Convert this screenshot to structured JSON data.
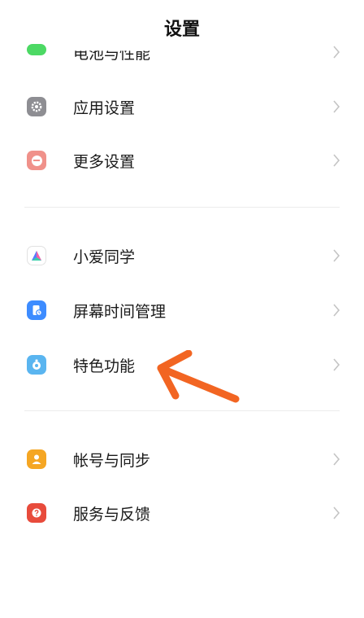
{
  "header": {
    "title": "设置"
  },
  "groups": [
    {
      "items": [
        {
          "label": "电池与性能",
          "icon": "battery-icon",
          "color": "#4cd964"
        },
        {
          "label": "应用设置",
          "icon": "gear-icon",
          "color": "#8e8e93"
        },
        {
          "label": "更多设置",
          "icon": "more-dots-icon",
          "color": "#f0918a"
        }
      ]
    },
    {
      "items": [
        {
          "label": "小爱同学",
          "icon": "xiaoai-icon",
          "color": "#ffffff"
        },
        {
          "label": "屏幕时间管理",
          "icon": "screen-time-icon",
          "color": "#3d8cff"
        },
        {
          "label": "特色功能",
          "icon": "features-icon",
          "color": "#5ab5f0"
        }
      ]
    },
    {
      "items": [
        {
          "label": "帐号与同步",
          "icon": "account-icon",
          "color": "#f5a623"
        },
        {
          "label": "服务与反馈",
          "icon": "feedback-icon",
          "color": "#e84b3c"
        }
      ]
    }
  ],
  "annotation": {
    "arrow_color": "#f26522",
    "target": "特色功能"
  }
}
